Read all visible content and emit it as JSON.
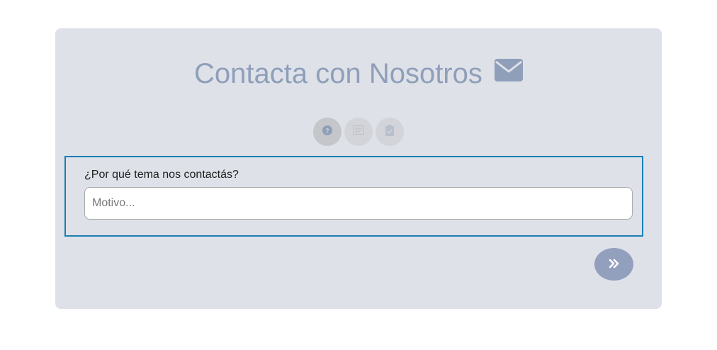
{
  "header": {
    "title": "Contacta con Nosotros",
    "title_icon": "envelope-icon"
  },
  "steps": [
    {
      "icon": "question-circle-icon",
      "state": "active"
    },
    {
      "icon": "message-icon",
      "state": "inactive"
    },
    {
      "icon": "clipboard-check-icon",
      "state": "inactive"
    }
  ],
  "form": {
    "topic_label": "¿Por qué tema nos contactás?",
    "topic_placeholder": "Motivo...",
    "topic_value": ""
  },
  "actions": {
    "next_icon": "double-chevron-right-icon"
  },
  "colors": {
    "card_bg": "#dee1e8",
    "accent": "#8f9fba",
    "focus_border": "#1a7fb5"
  }
}
